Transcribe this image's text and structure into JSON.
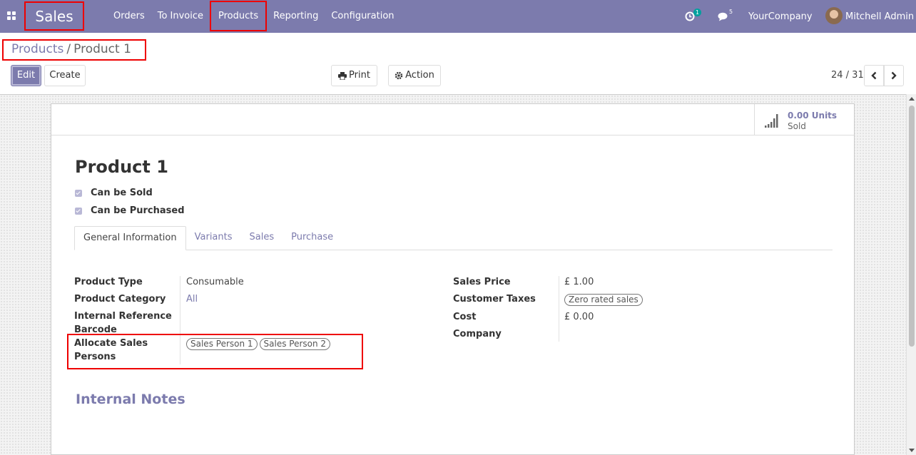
{
  "navbar": {
    "app_name": "Sales",
    "menu": [
      {
        "label": "Orders"
      },
      {
        "label": "To Invoice"
      },
      {
        "label": "Products"
      },
      {
        "label": "Reporting"
      },
      {
        "label": "Configuration"
      }
    ],
    "activity_count": "1",
    "message_count": "5",
    "company": "YourCompany",
    "user": "Mitchell Admin"
  },
  "breadcrumb": {
    "parent": "Products",
    "separator": "/",
    "current": "Product 1"
  },
  "buttons": {
    "edit": "Edit",
    "create": "Create",
    "print": "Print",
    "action": "Action"
  },
  "pager": {
    "value": "24 / 31"
  },
  "stat": {
    "value": "0.00 Units",
    "label": "Sold"
  },
  "product": {
    "name": "Product 1",
    "checkboxes": [
      {
        "label": "Can be Sold",
        "checked": true
      },
      {
        "label": "Can be Purchased",
        "checked": true
      }
    ]
  },
  "tabs": [
    {
      "label": "General Information",
      "active": true
    },
    {
      "label": "Variants"
    },
    {
      "label": "Sales"
    },
    {
      "label": "Purchase"
    }
  ],
  "fields_left": {
    "product_type_label": "Product Type",
    "product_type_value": "Consumable",
    "product_category_label": "Product Category",
    "product_category_value": "All",
    "internal_reference_label": "Internal Reference",
    "barcode_label": "Barcode",
    "allocate_label_line1": "Allocate Sales",
    "allocate_label_line2": "Persons",
    "allocate_tags": [
      "Sales Person 1",
      "Sales Person 2"
    ]
  },
  "fields_right": {
    "sales_price_label": "Sales Price",
    "sales_price_value": "£ 1.00",
    "customer_taxes_label": "Customer Taxes",
    "customer_taxes_tag": "Zero rated sales",
    "cost_label": "Cost",
    "cost_value": "£ 0.00",
    "company_label": "Company"
  },
  "notes_heading": "Internal Notes",
  "colors": {
    "brand": "#7c7bad",
    "highlight": "#ee0000",
    "badge": "#00a09d"
  }
}
